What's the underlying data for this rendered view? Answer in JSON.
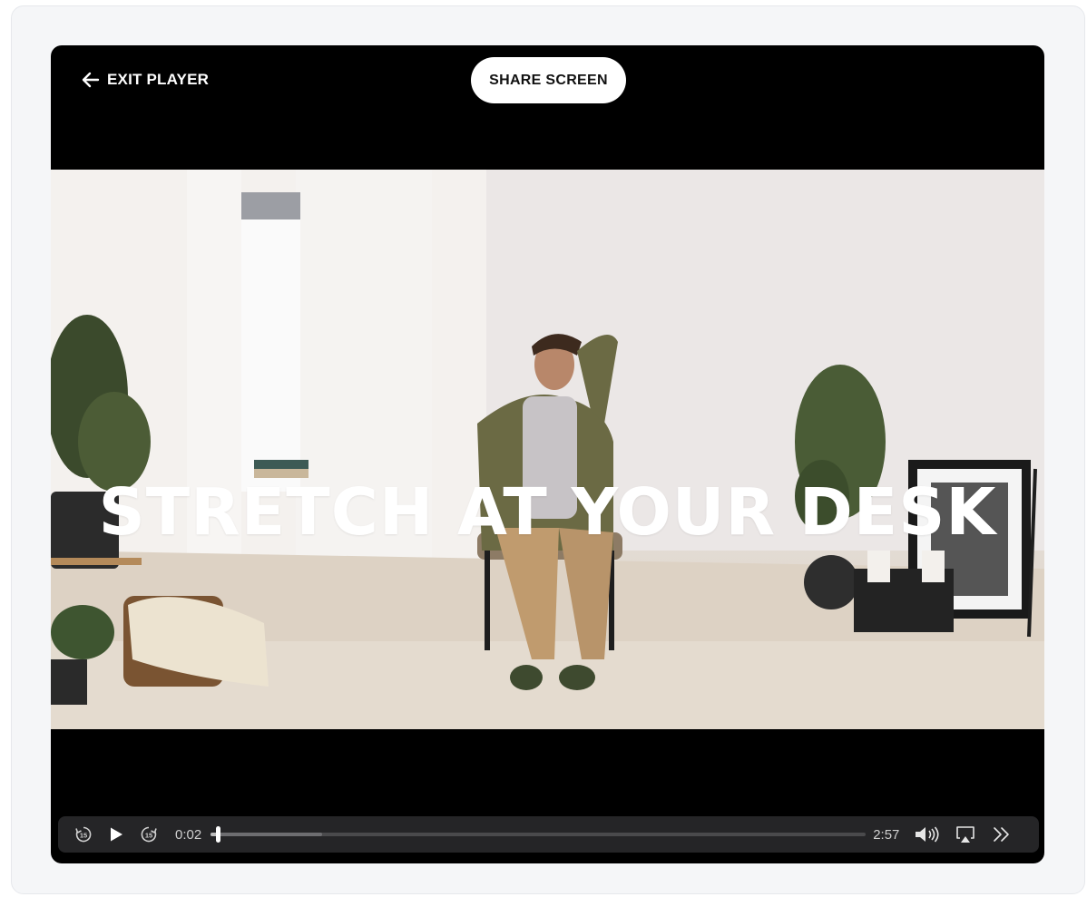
{
  "top_bar": {
    "exit_label": "EXIT PLAYER",
    "share_label": "SHARE SCREEN"
  },
  "video": {
    "title_overlay": "STRETCH AT YOUR DESK"
  },
  "controls": {
    "rewind_icon": "rewind-15-icon",
    "rewind_seconds": "15",
    "play_icon": "play-icon",
    "forward_icon": "forward-15-icon",
    "forward_seconds": "15",
    "current_time": "0:02",
    "duration": "2:57",
    "played_fraction": 0.011,
    "buffered_fraction": 0.17,
    "volume_icon": "volume-icon",
    "airplay_icon": "airplay-icon",
    "speed_icon": "chevrons-right-icon"
  },
  "colors": {
    "player_bg": "#000000",
    "controls_bg": "#28282a",
    "text_white": "#ffffff"
  }
}
